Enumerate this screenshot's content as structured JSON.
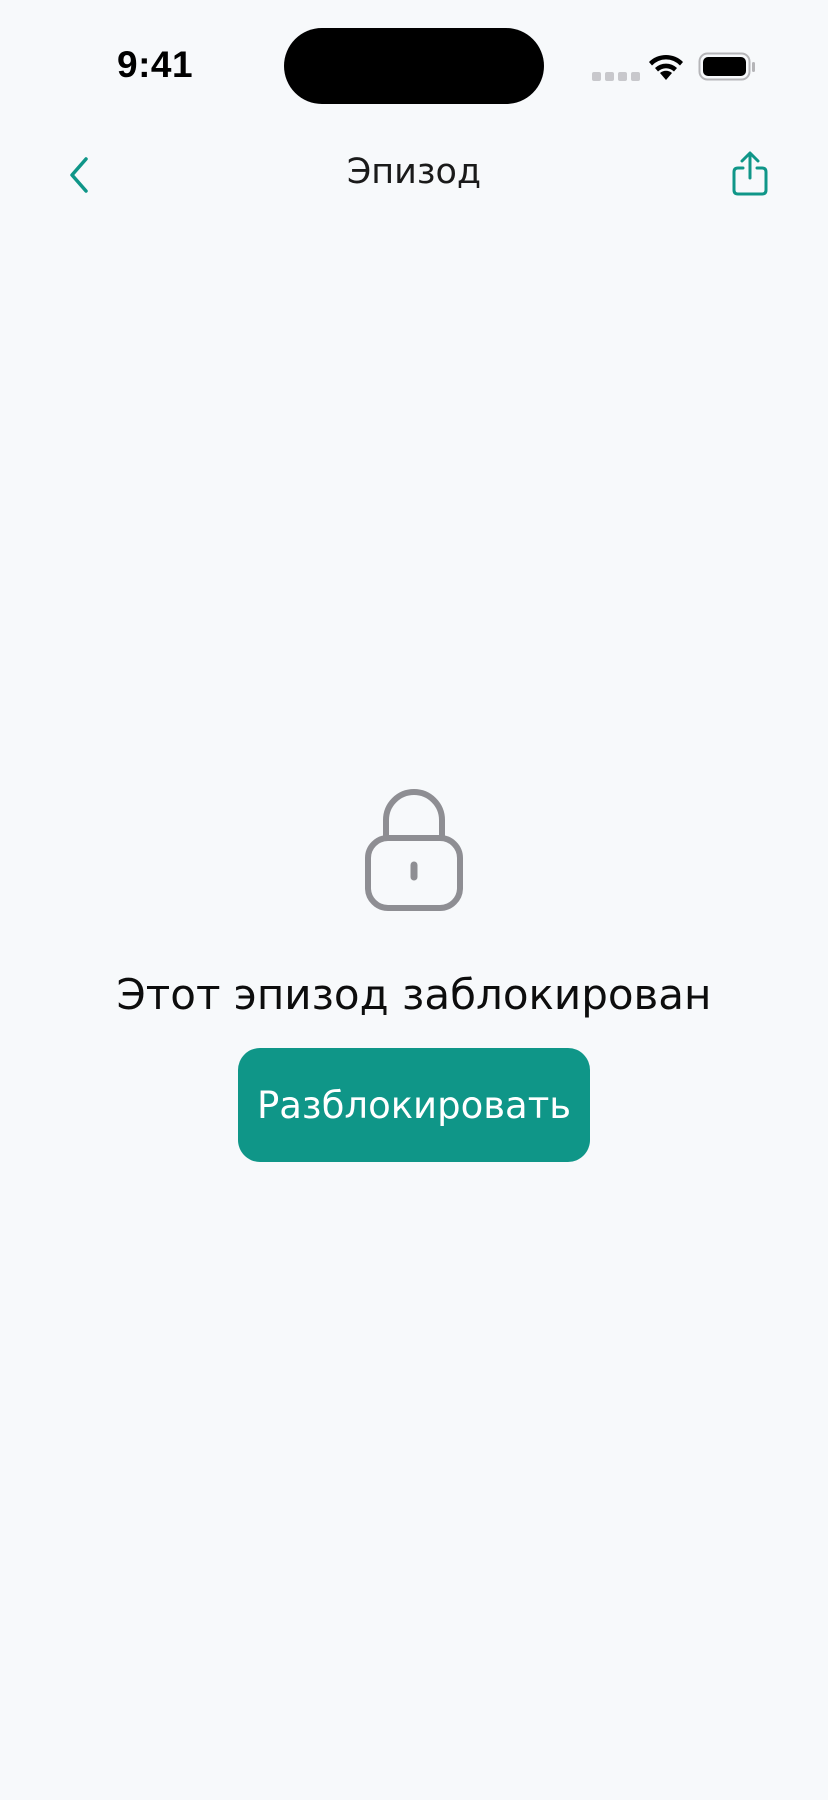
{
  "status_bar": {
    "time": "9:41"
  },
  "nav": {
    "title": "Эпизод",
    "back_icon": "chevron-left-icon",
    "share_icon": "share-icon"
  },
  "content": {
    "lock_icon": "lock-icon",
    "message": "Этот эпизод заблокирован",
    "unlock_label": "Разблокировать"
  },
  "colors": {
    "accent": "#0f9688",
    "background": "#f7f9fb",
    "lock_gray": "#8e8e93"
  }
}
